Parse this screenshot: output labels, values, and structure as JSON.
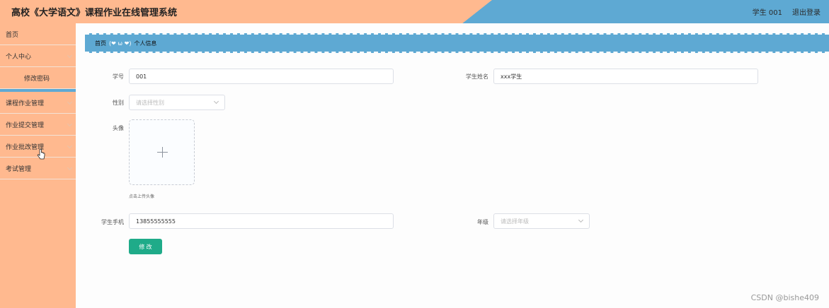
{
  "header": {
    "title": "高校《大学语文》课程作业在线管理系统",
    "user": "学生 001",
    "logout": "退出登录"
  },
  "sidebar": {
    "items": [
      {
        "label": "首页"
      },
      {
        "label": "个人中心"
      },
      {
        "label": "修改密码"
      },
      {
        "label": "课程作业管理"
      },
      {
        "label": "作业提交管理"
      },
      {
        "label": "作业批改管理"
      },
      {
        "label": "考试管理"
      }
    ]
  },
  "breadcrumb": {
    "home": "首页",
    "face": "(❤ ω ❤)",
    "current": "个人信息"
  },
  "form": {
    "student_no_label": "学号",
    "student_no_value": "001",
    "student_name_label": "学生姓名",
    "student_name_value": "xxx学生",
    "gender_label": "性别",
    "gender_placeholder": "请选择性别",
    "avatar_label": "头像",
    "avatar_hint": "点击上传头像",
    "phone_label": "学生手机",
    "phone_value": "13855555555",
    "grade_label": "年级",
    "grade_placeholder": "请选择年级",
    "submit_label": "修 改"
  },
  "watermark": "CSDN @bishe409",
  "colors": {
    "accent_blue": "#5ea9d3",
    "peach": "#ffb98f",
    "button_green": "#1fab89"
  }
}
